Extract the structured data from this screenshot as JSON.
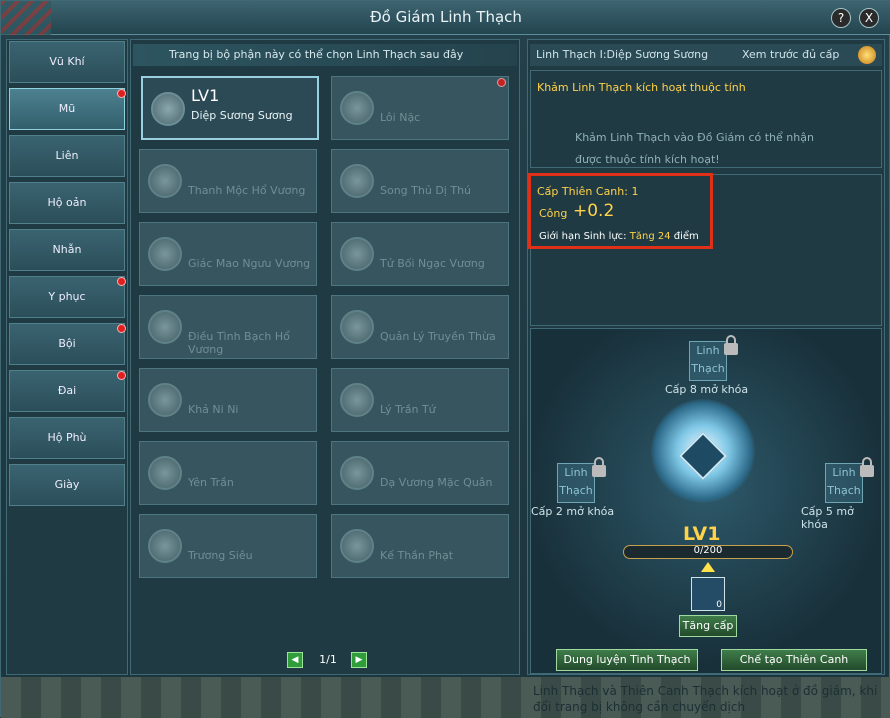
{
  "window": {
    "title": "Đồ Giám Linh Thạch",
    "help_label": "?",
    "close_label": "X"
  },
  "categories": [
    {
      "label": "Vũ Khí",
      "dot": false
    },
    {
      "label": "Mũ",
      "dot": true
    },
    {
      "label": "Liên",
      "dot": false
    },
    {
      "label": "Hộ oản",
      "dot": false
    },
    {
      "label": "Nhẫn",
      "dot": false
    },
    {
      "label": "Y phục",
      "dot": true
    },
    {
      "label": "Bội",
      "dot": true
    },
    {
      "label": "Đai",
      "dot": true
    },
    {
      "label": "Hộ Phù",
      "dot": false
    },
    {
      "label": "Giày",
      "dot": false
    }
  ],
  "mid": {
    "header": "Trang bị bộ phận này có thể chọn Linh Thạch sau đây",
    "cards": [
      {
        "name": "Diệp Sương Sương",
        "level": "LV1",
        "dot": false
      },
      {
        "name": "Lôi Nặc",
        "level": "",
        "dot": true
      },
      {
        "name": "Thanh Mộc Hổ Vương",
        "level": "",
        "dot": false
      },
      {
        "name": "Song Thủ Dị Thú",
        "level": "",
        "dot": false
      },
      {
        "name": "Giác Mao Ngưu Vương",
        "level": "",
        "dot": false
      },
      {
        "name": "Tử Bối Ngạc Vương",
        "level": "",
        "dot": false
      },
      {
        "name": "Điều Tình Bạch Hổ Vương",
        "level": "",
        "dot": false
      },
      {
        "name": "Quản Lý Truyền Thừa",
        "level": "",
        "dot": false
      },
      {
        "name": "Khả Ni Ni",
        "level": "",
        "dot": false
      },
      {
        "name": "Lý Trần Tứ",
        "level": "",
        "dot": false
      },
      {
        "name": "Yên Trần",
        "level": "",
        "dot": false
      },
      {
        "name": "Dạ Vương Mặc Quân",
        "level": "",
        "dot": false
      },
      {
        "name": "Trương Siêu",
        "level": "",
        "dot": false
      },
      {
        "name": "Kế Thần Phạt",
        "level": "",
        "dot": false
      }
    ],
    "page": "1/1"
  },
  "right": {
    "header": "Linh Thạch I:Diệp Sương Sương",
    "preview": "Xem trước đủ cấp",
    "activate_title": "Khảm Linh Thạch kích hoạt thuộc tính",
    "activate_desc1": "Khảm Linh Thạch vào Đồ Giám có thể nhận",
    "activate_desc2": "được thuộc tính kích hoạt!",
    "tier_label": "Cấp Thiên Canh: 1",
    "attack_label": "Công",
    "attack_value": "+0.2",
    "hp_prefix": "Giới hạn Sinh lực:",
    "hp_value": "Tăng 24",
    "hp_suffix": "điểm",
    "slot_label1": "Linh",
    "slot_label2": "Thạch",
    "unlock_top": "Cấp 8 mở khóa",
    "unlock_left": "Cấp 2 mở khóa",
    "unlock_right": "Cấp 5 mở khóa",
    "level": "LV1",
    "progress": "0/200",
    "material_count": "0",
    "upgrade_label": "Tăng cấp",
    "btn_train": "Dung luyện Tinh Thạch",
    "btn_craft": "Chế tạo Thiên Canh Thạch"
  },
  "footer": {
    "text": "Linh Thạch và Thiên Canh Thạch kích hoạt ở đồ giám, khi đổi trang bị không cần chuyển dịch"
  }
}
